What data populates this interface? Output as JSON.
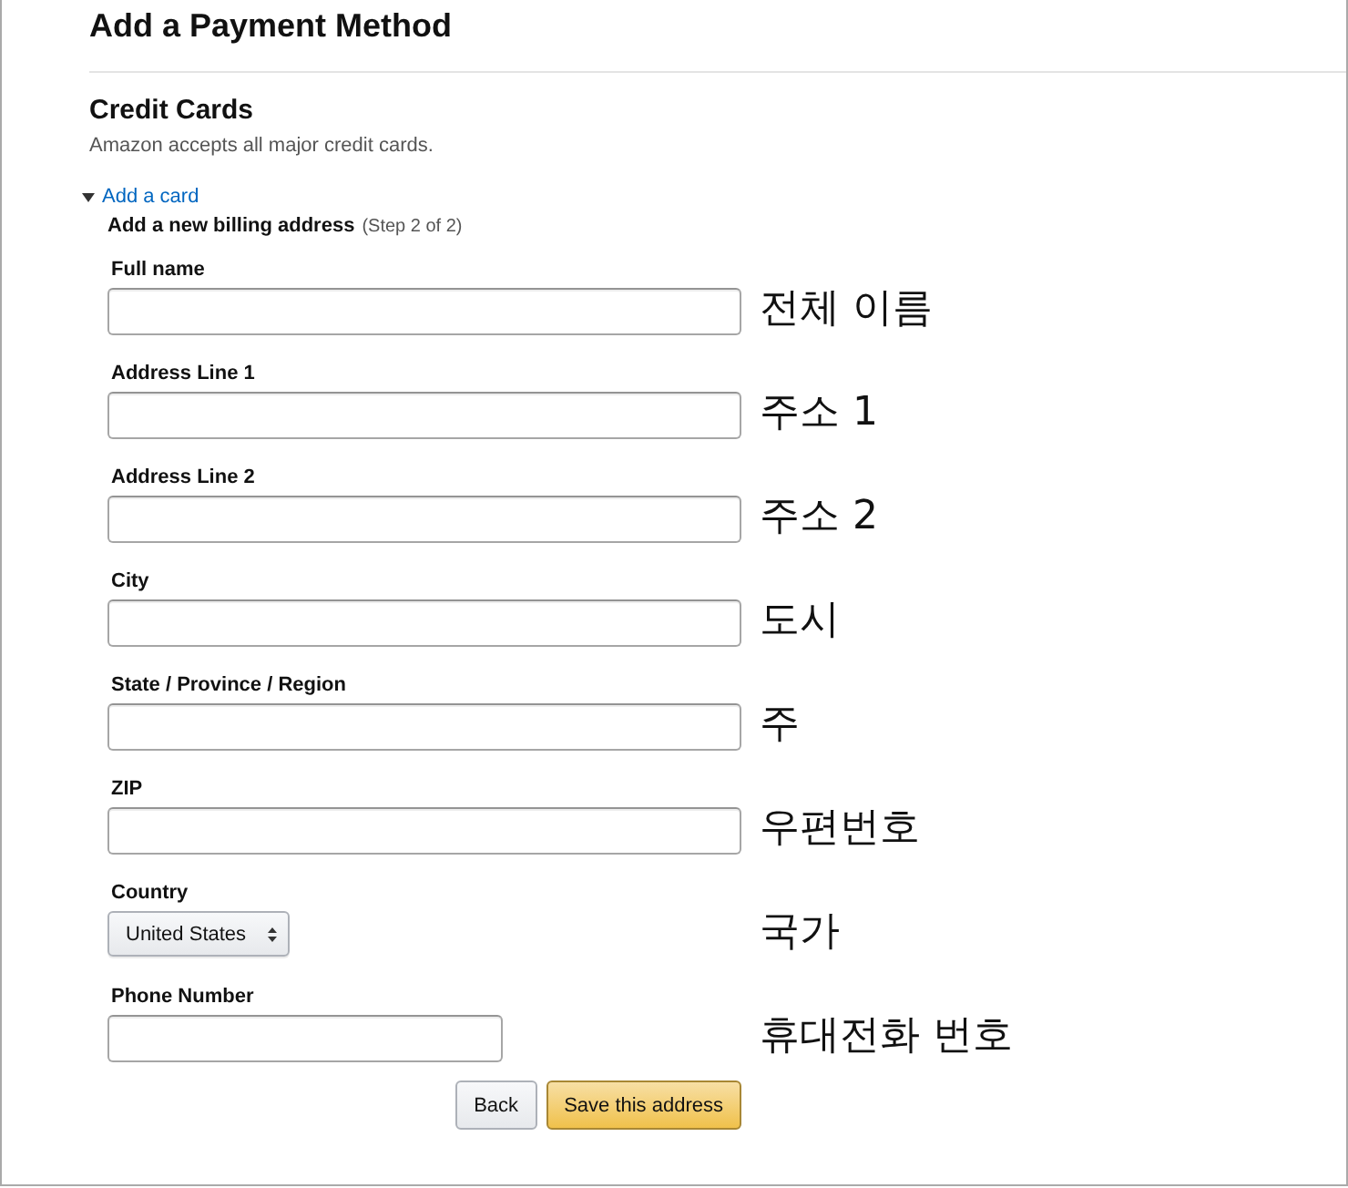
{
  "page_title": "Add a Payment Method",
  "section": {
    "title": "Credit Cards",
    "subtitle": "Amazon accepts all major credit cards."
  },
  "add_card": {
    "label": "Add a card",
    "expanded": true
  },
  "form": {
    "title": "Add a new billing address",
    "step": "(Step 2 of 2)",
    "fields": [
      {
        "kind": "text",
        "label": "Full name",
        "note": "전체 이름"
      },
      {
        "kind": "text",
        "label": "Address Line 1",
        "note": "주소 1"
      },
      {
        "kind": "text",
        "label": "Address Line 2",
        "note": "주소 2"
      },
      {
        "kind": "text",
        "label": "City",
        "note": "도시"
      },
      {
        "kind": "text",
        "label": "State / Province / Region",
        "note": "주"
      },
      {
        "kind": "text",
        "label": "ZIP",
        "note": "우편번호"
      },
      {
        "kind": "select",
        "label": "Country",
        "value": "United States",
        "note": "국가"
      },
      {
        "kind": "short-text",
        "label": "Phone Number",
        "note": "휴대전화 번호"
      }
    ],
    "buttons": [
      {
        "kind": "secondary",
        "label": "Back"
      },
      {
        "kind": "primary",
        "label": "Save this address"
      }
    ]
  }
}
